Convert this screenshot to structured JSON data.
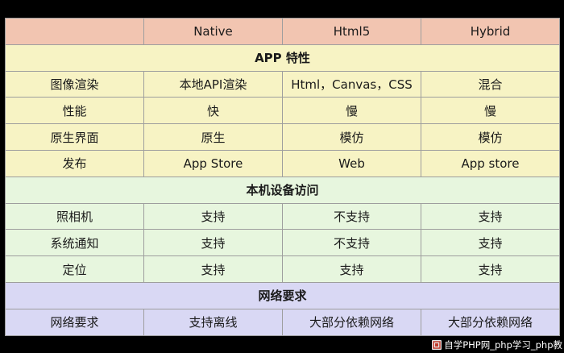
{
  "header": [
    "",
    "Native",
    "Html5",
    "Hybrid"
  ],
  "sections": [
    {
      "title": "APP 特性",
      "rows": [
        [
          "图像渲染",
          "本地API渲染",
          "Html，Canvas，CSS",
          "混合"
        ],
        [
          "性能",
          "快",
          "慢",
          "慢"
        ],
        [
          "原生界面",
          "原生",
          "模仿",
          "模仿"
        ],
        [
          "发布",
          "App Store",
          "Web",
          "App store"
        ]
      ]
    },
    {
      "title": "本机设备访问",
      "rows": [
        [
          "照相机",
          "支持",
          "不支持",
          "支持"
        ],
        [
          "系统通知",
          "支持",
          "不支持",
          "支持"
        ],
        [
          "定位",
          "支持",
          "支持",
          "支持"
        ]
      ]
    },
    {
      "title": "网络要求",
      "rows": [
        [
          "网络要求",
          "支持离线",
          "大部分依赖网络",
          "大部分依赖网络"
        ]
      ]
    }
  ],
  "watermark": {
    "text": "自学PHP网_php学习_php教",
    "icon": "php-logo-icon"
  },
  "colors": {
    "header": "#f2c5b1",
    "section_1": "#f7f3c4",
    "section_2": "#e7f6de",
    "section_3": "#d9d8f4",
    "border": "#9e9e9e"
  }
}
